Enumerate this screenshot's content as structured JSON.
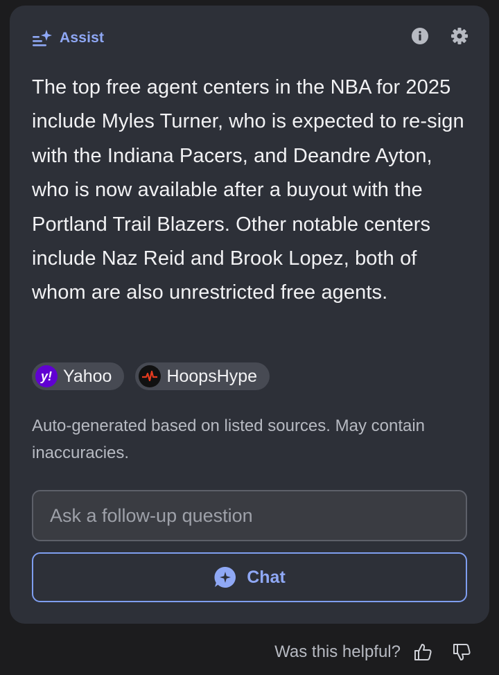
{
  "header": {
    "title": "Assist",
    "icons": {
      "assist": "sparkle-list-icon",
      "info": "info-icon",
      "settings": "gear-icon"
    }
  },
  "answer": {
    "text": "The top free agent centers in the NBA for 2025 include Myles Turner, who is expected to re-sign with the Indiana Pacers, and Deandre Ayton, who is now available after a buyout with the Portland Trail Blazers. Other notable centers include Naz Reid and Brook Lopez, both of whom are also unrestricted free agents."
  },
  "sources": [
    {
      "label": "Yahoo",
      "logo_text": "y!",
      "logo_color": "#6001d2"
    },
    {
      "label": "HoopsHype",
      "logo_color": "#e63b1f"
    }
  ],
  "disclaimer": "Auto-generated based on listed sources. May contain inaccuracies.",
  "followup": {
    "placeholder": "Ask a follow-up question",
    "value": ""
  },
  "chat_button": {
    "label": "Chat",
    "icon": "chat-sparkle-icon"
  },
  "feedback": {
    "question": "Was this helpful?",
    "icons": [
      "thumbs-up-icon",
      "thumbs-down-icon"
    ]
  },
  "colors": {
    "accent": "#8fa8f5",
    "card": "#2d3038",
    "page": "#1c1c1e"
  }
}
